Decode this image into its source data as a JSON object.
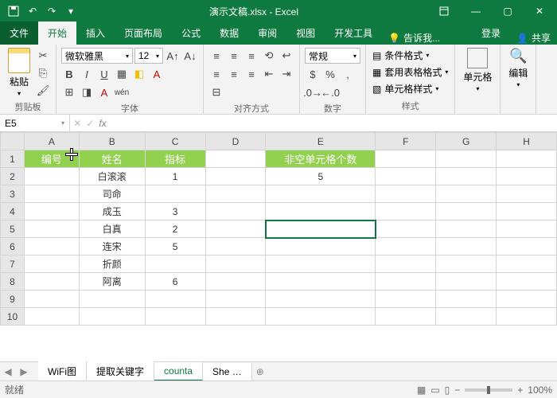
{
  "titlebar": {
    "title": "演示文稿.xlsx - Excel"
  },
  "tabs": {
    "file": "文件",
    "home": "开始",
    "insert": "插入",
    "layout": "页面布局",
    "formula": "公式",
    "data": "数据",
    "review": "审阅",
    "view": "视图",
    "dev": "开发工具",
    "tellme": "告诉我...",
    "login": "登录",
    "share": "共享"
  },
  "ribbon": {
    "clipboard": {
      "label": "剪贴板",
      "paste": "粘贴"
    },
    "font": {
      "label": "字体",
      "name": "微软雅黑",
      "size": "12",
      "b": "B",
      "i": "I",
      "u": "U"
    },
    "align": {
      "label": "对齐方式"
    },
    "number": {
      "label": "数字",
      "format": "常规"
    },
    "styles": {
      "label": "样式",
      "cond": "条件格式",
      "table": "套用表格格式",
      "cell": "单元格样式"
    },
    "cells": {
      "label": "单元格"
    },
    "editing": {
      "label": "编辑"
    }
  },
  "namebox": {
    "ref": "E5",
    "fx": "fx",
    "fbar": ""
  },
  "cols": [
    "A",
    "B",
    "C",
    "D",
    "E",
    "F",
    "G",
    "H"
  ],
  "rows": [
    "1",
    "2",
    "3",
    "4",
    "5",
    "6",
    "7",
    "8",
    "9",
    "10"
  ],
  "headers": {
    "A": "编号",
    "B": "姓名",
    "C": "指标",
    "E": "非空单元格个数"
  },
  "data": {
    "B2": "白滚滚",
    "C2": "1",
    "E2": "5",
    "B3": "司命",
    "B4": "成玉",
    "C4": "3",
    "B5": "白真",
    "C5": "2",
    "B6": "连宋",
    "C6": "5",
    "B7": "折颜",
    "B8": "阿离",
    "C8": "6"
  },
  "selection": "E5",
  "sheettabs": {
    "t1": "WiFi图",
    "t2": "提取关键字",
    "t3": "counta",
    "t4": "She"
  },
  "status": {
    "ready": "就绪",
    "zoom": "100%"
  },
  "chart_data": {
    "type": "table",
    "title": "非空单元格个数",
    "columns": [
      "编号",
      "姓名",
      "指标"
    ],
    "rows": [
      {
        "编号": "",
        "姓名": "白滚滚",
        "指标": 1
      },
      {
        "编号": "",
        "姓名": "司命",
        "指标": null
      },
      {
        "编号": "",
        "姓名": "成玉",
        "指标": 3
      },
      {
        "编号": "",
        "姓名": "白真",
        "指标": 2
      },
      {
        "编号": "",
        "姓名": "连宋",
        "指标": 5
      },
      {
        "编号": "",
        "姓名": "折颜",
        "指标": null
      },
      {
        "编号": "",
        "姓名": "阿离",
        "指标": 6
      }
    ],
    "result": {
      "label": "非空单元格个数",
      "value": 5
    }
  }
}
